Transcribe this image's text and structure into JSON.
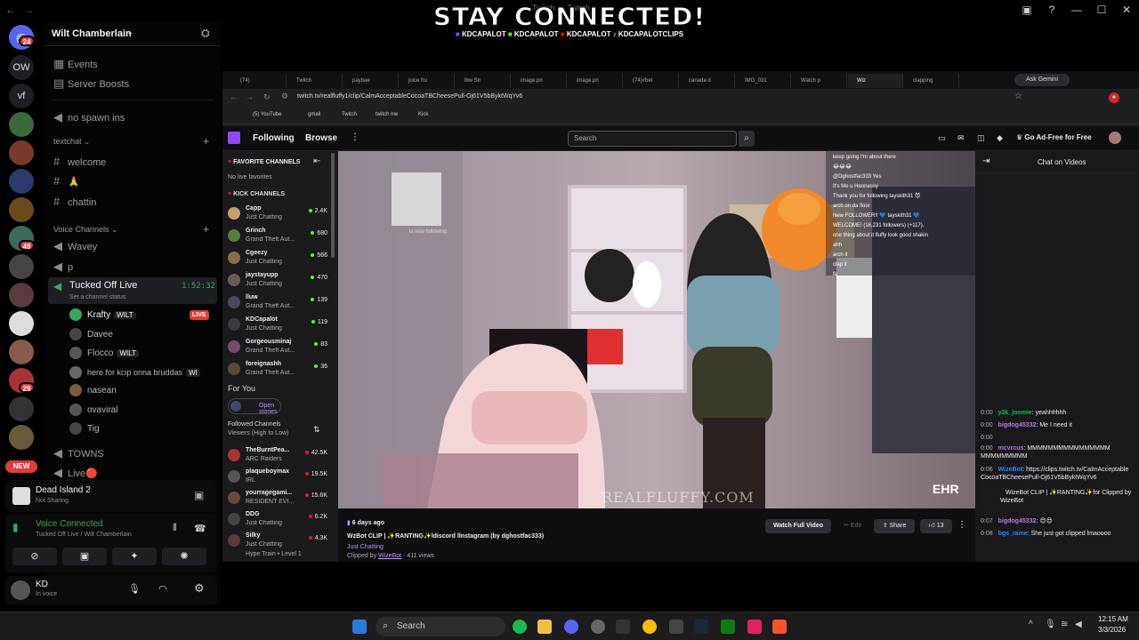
{
  "titlebar": {
    "back": "←",
    "center_text": "Twitch — Twitch",
    "min": "—",
    "max": "☐",
    "close": "✕",
    "help": "?"
  },
  "overlay": {
    "headline": "STAY CONNECTED!",
    "handles": [
      "KDCAPALOT",
      "KDCAPALOT",
      "KDCAPALOT",
      "KDCAPALOTCLIPS"
    ]
  },
  "rail": {
    "dm_badge": "24",
    "servers": [
      {
        "label": "OW"
      },
      {
        "label": "vf"
      },
      {
        "badge": "49"
      },
      {
        "badge": "29"
      }
    ],
    "new_label": "NEW"
  },
  "discord": {
    "server_name": "Wilt Chamberlain",
    "top_items": [
      {
        "label": "Events"
      },
      {
        "label": "Server Boosts"
      }
    ],
    "channels_top": [
      {
        "label": "no spawn ins"
      }
    ],
    "category_text": "textchat",
    "text_channels": [
      {
        "label": "welcome"
      },
      {
        "label": "🙏"
      },
      {
        "label": "chattin"
      }
    ],
    "category_voice": "Voice Channels",
    "voice_channels": [
      {
        "label": "Wavey"
      },
      {
        "label": "p"
      }
    ],
    "active_voice": {
      "label": "Tucked Off Live",
      "timer": "1:52:32",
      "status": "Set a channel status"
    },
    "voice_users": [
      {
        "name": "Krafty",
        "tag": "WILT",
        "live": "LIVE",
        "color": "#3ba55d"
      },
      {
        "name": "Davee",
        "color": "#444"
      },
      {
        "name": "Flocco",
        "tag": "WILT",
        "color": "#555"
      },
      {
        "name": "here for kcip onna bruddas",
        "tag": "WI",
        "color": "#666"
      },
      {
        "name": "nasean",
        "color": "#7a5a3a"
      },
      {
        "name": "ovaviral",
        "color": "#555"
      },
      {
        "name": "Tig",
        "color": "#444"
      }
    ],
    "other_channels": [
      {
        "label": "TOWNS"
      },
      {
        "label": "Live🔴"
      }
    ],
    "game": {
      "title": "Dead Island 2",
      "sub": "Not Sharing"
    },
    "voice_panel": {
      "status": "Voice Connected",
      "sub": "Tucked Off Live / Wilt Chamberlain"
    },
    "user": {
      "name": "KD",
      "status": "In voice"
    }
  },
  "browser": {
    "tabs": [
      "(74)",
      "Twitch",
      "paybae",
      "juice fru",
      "lbw Str",
      "image.pn",
      "image.pn",
      "(74)#bet",
      "canada d",
      "IMG_031",
      "Watch p",
      "Wiz",
      "clapping"
    ],
    "ask_gemini": "Ask Gemini",
    "url": "twitch.tv/realfluffy1/clip/CalmAcceptableCocoaTBCheesePull-Oj61V5bByktWqYv6",
    "bookmarks": [
      "(5) YouTube",
      "gmail",
      "Twitch",
      "twitch me",
      "Kick"
    ]
  },
  "twitch": {
    "nav": {
      "following": "Following",
      "browse": "Browse",
      "more": "⋮",
      "search_placeholder": "Search",
      "ad_free": "Go Ad-Free for Free"
    },
    "sidebar": {
      "fav_header": "FAVORITE CHANNELS",
      "no_live": "No live favorites",
      "kick_header": "KICK CHANNELS",
      "kick_channels": [
        {
          "name": "Capp",
          "game": "Just Chatting",
          "viewers": "2.4K",
          "color": "#c9a06c"
        },
        {
          "name": "Grinch",
          "game": "Grand Theft Aut...",
          "viewers": "680",
          "color": "#5a7a3a"
        },
        {
          "name": "Cgeezy",
          "game": "Just Chatting",
          "viewers": "566",
          "color": "#8a6a4a"
        },
        {
          "name": "jaystayupp",
          "game": "Just Chatting",
          "viewers": "470",
          "color": "#6a5a5a"
        },
        {
          "name": "lluw",
          "game": "Grand Theft Aut...",
          "viewers": "139",
          "color": "#4a4a5a"
        },
        {
          "name": "KDCapalot",
          "game": "Just Chatting",
          "viewers": "119",
          "color": "#3a3a3a"
        },
        {
          "name": "Gorgeousminaj",
          "game": "Grand Theft Aut...",
          "viewers": "83",
          "color": "#7a4a6a"
        },
        {
          "name": "foreignashh",
          "game": "Grand Theft Aut...",
          "viewers": "36",
          "color": "#5a4a3a"
        }
      ],
      "for_you": "For You",
      "open_stories": "Open stories",
      "followed": "Followed Channels",
      "followed_sort": "Viewers (High to Low)",
      "followed_channels": [
        {
          "name": "TheBurntPea...",
          "game": "ARC Raiders",
          "viewers": "42.5K",
          "color": "#a33"
        },
        {
          "name": "plaqueboymax",
          "game": "IRL",
          "viewers": "19.5K",
          "color": "#555"
        },
        {
          "name": "yourragegami...",
          "game": "RESIDENT EVI...",
          "viewers": "15.6K",
          "color": "#6a4a3a"
        },
        {
          "name": "DDG",
          "game": "Just Chatting",
          "viewers": "6.2K",
          "color": "#444"
        },
        {
          "name": "Silky",
          "game": "Just Chatting",
          "viewers": "4.3K",
          "color": "#5a3a3a"
        }
      ],
      "hype_train": "Hype Train • Level 1"
    },
    "video": {
      "watermark": "REALFLUFFY.COM",
      "corner": "EHR",
      "follow_text": "is now following",
      "overlay_chat": [
        "keep going I'm about there",
        "😂😂😂",
        "@Dghostfac333 Yes",
        "It's Me u Hennessy",
        "Thank you for following tayskith31 😈",
        "arch on da floor",
        "New FOLLOWER!! 💙 tayskith31 💙",
        "WELCOME! (16,231 followers) (+117).",
        "one thing about it fluffy look good shakin",
        "ahh",
        "arch it",
        "clap it",
        "fa"
      ]
    },
    "clip_info": {
      "age": "6 days ago",
      "title": "WzBot CLIP | ✨RANTING✨ldiscord llnstagram (by dghostfac333)",
      "category": "Just Chatting",
      "clipped_by_prefix": "Clipped by ",
      "clipper": "WizeBot",
      "views": " · 411 views",
      "watch_full": "Watch Full Video",
      "edit": "Edit",
      "share": "Share",
      "likes": "13"
    },
    "chat": {
      "title": "Chat on Videos",
      "messages": [
        {
          "ts": "0:00",
          "user": "y2k_joomie",
          "color": "#00c850",
          "text": "yeahhhhhh"
        },
        {
          "ts": "0:00",
          "user": "bigdog45332",
          "color": "#b87ae0",
          "text": "Me I need it"
        },
        {
          "ts": "0:00",
          "user": "",
          "color": "#b87ae0",
          "text": ""
        },
        {
          "ts": "0:00",
          "user": "mcvrcus",
          "color": "#b87ae0",
          "text": "MMMMMMMMMMMMMMMM MMMMMMMMM"
        },
        {
          "ts": "0:06",
          "user": "WizeBot",
          "color": "#1e90ff",
          "text": "https://clips.twitch.tv/CalmAcceptableCocoaTBCheesePull-Oj61V5bByktWqYv6"
        },
        {
          "ts": "",
          "user": "",
          "color": "#fff",
          "text": "WizeBot CLIP | ✨RANTING✨for Clipped by WizeBot"
        },
        {
          "ts": "0:07",
          "user": "bigdog45332",
          "color": "#b87ae0",
          "text": "😍😍"
        },
        {
          "ts": "0:08",
          "user": "bgs_raine",
          "color": "#1e90ff",
          "text": "She just got clipped lmaoooo"
        }
      ]
    }
  },
  "taskbar": {
    "search": "Search",
    "time": "12:15 AM",
    "date": "3/3/2026",
    "tray_up": "^"
  }
}
